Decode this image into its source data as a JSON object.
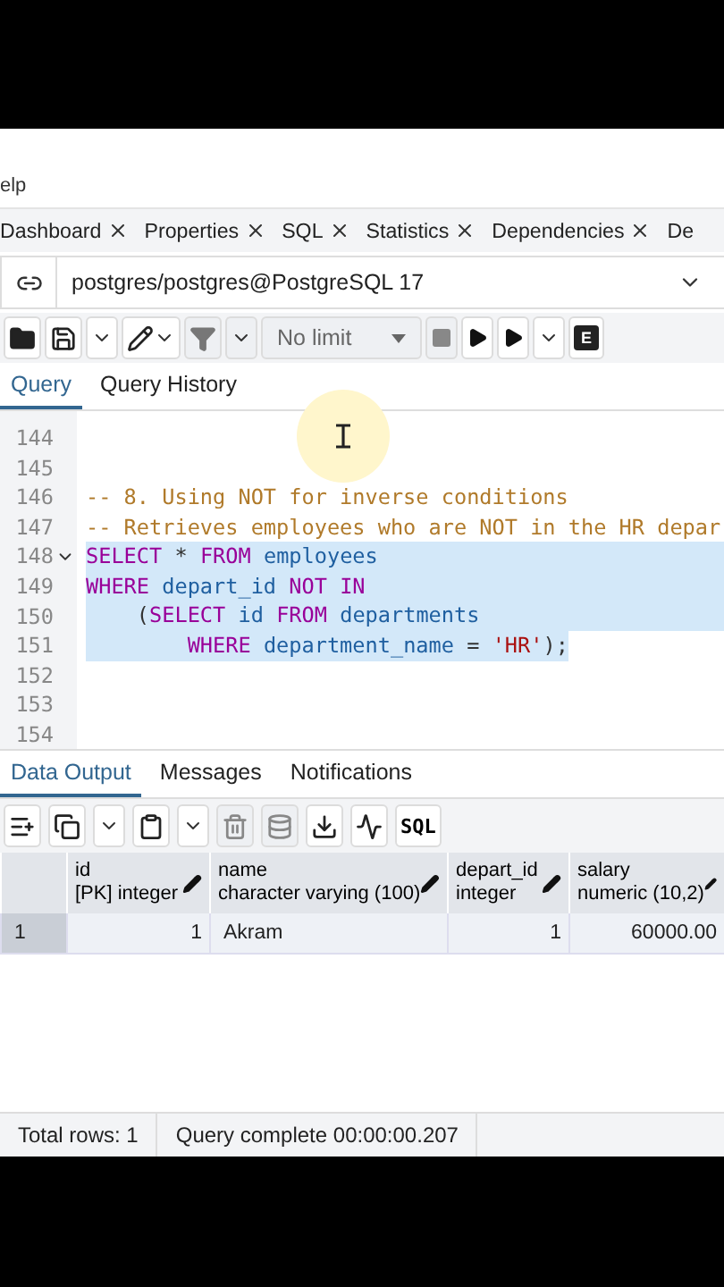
{
  "menu": {
    "label": "elp"
  },
  "tabs": [
    {
      "label": "Dashboard",
      "selected": false
    },
    {
      "label": "Properties",
      "selected": false
    },
    {
      "label": "SQL",
      "selected": false
    },
    {
      "label": "Statistics",
      "selected": false
    },
    {
      "label": "Dependencies",
      "selected": false
    },
    {
      "label": "De",
      "selected": false
    }
  ],
  "connection": {
    "label": "postgres/postgres@PostgreSQL 17"
  },
  "toolbar": {
    "limit": "No limit",
    "explain_key": "E"
  },
  "editor_tabs": [
    {
      "label": "Query",
      "selected": true
    },
    {
      "label": "Query History",
      "selected": false
    }
  ],
  "editor": {
    "lines": [
      {
        "number": "144",
        "selected": false
      },
      {
        "number": "145",
        "selected": false
      },
      {
        "number": "146",
        "selected": false,
        "tokens": [
          {
            "kind": "comment",
            "text": "-- 8. Using NOT for inverse conditions"
          }
        ]
      },
      {
        "number": "147",
        "selected": false,
        "tokens": [
          {
            "kind": "comment",
            "text": "-- Retrieves employees who are NOT in the HR depar"
          }
        ]
      },
      {
        "number": "148",
        "selected": true,
        "fold": true,
        "tokens": [
          {
            "kind": "keyword",
            "text": "SELECT"
          },
          {
            "kind": "plain",
            "text": " * "
          },
          {
            "kind": "keyword",
            "text": "FROM"
          },
          {
            "kind": "ident",
            "text": " employees"
          }
        ]
      },
      {
        "number": "149",
        "selected": true,
        "tokens": [
          {
            "kind": "keyword",
            "text": "WHERE"
          },
          {
            "kind": "ident",
            "text": " depart_id "
          },
          {
            "kind": "keyword",
            "text": "NOT IN"
          }
        ]
      },
      {
        "number": "150",
        "selected": true,
        "tokens": [
          {
            "kind": "plain",
            "text": "    ("
          },
          {
            "kind": "keyword",
            "text": "SELECT"
          },
          {
            "kind": "ident",
            "text": " id "
          },
          {
            "kind": "keyword",
            "text": "FROM"
          },
          {
            "kind": "ident",
            "text": " departments"
          }
        ]
      },
      {
        "number": "151",
        "selected": true,
        "tokens": [
          {
            "kind": "keyword",
            "text": "        WHERE"
          },
          {
            "kind": "ident",
            "text": " department_name "
          },
          {
            "kind": "plain",
            "text": "= "
          },
          {
            "kind": "string",
            "text": "'HR'"
          },
          {
            "kind": "plain",
            "text": ");"
          }
        ]
      },
      {
        "number": "152",
        "selected": false
      },
      {
        "number": "153",
        "selected": false
      },
      {
        "number": "154",
        "selected": false
      }
    ]
  },
  "output_tabs": [
    {
      "label": "Data Output",
      "selected": true
    },
    {
      "label": "Messages",
      "selected": false
    },
    {
      "label": "Notifications",
      "selected": false
    }
  ],
  "grid_toolbar": {
    "sql_label": "SQL"
  },
  "table": {
    "columns": [
      {
        "name": "id",
        "type": "[PK] integer",
        "kind": "number"
      },
      {
        "name": "name",
        "type": "character varying (100)",
        "kind": "text"
      },
      {
        "name": "depart_id",
        "type": "integer",
        "kind": "number"
      },
      {
        "name": "salary",
        "type": "numeric (10,2)",
        "kind": "number"
      }
    ],
    "rows": [
      {
        "row_number": "1",
        "cells": [
          "1",
          "Akram",
          "1",
          "60000.00"
        ]
      }
    ]
  },
  "status_bar": {
    "total": "Total rows: 1",
    "message": "Query complete 00:00:00.207"
  }
}
